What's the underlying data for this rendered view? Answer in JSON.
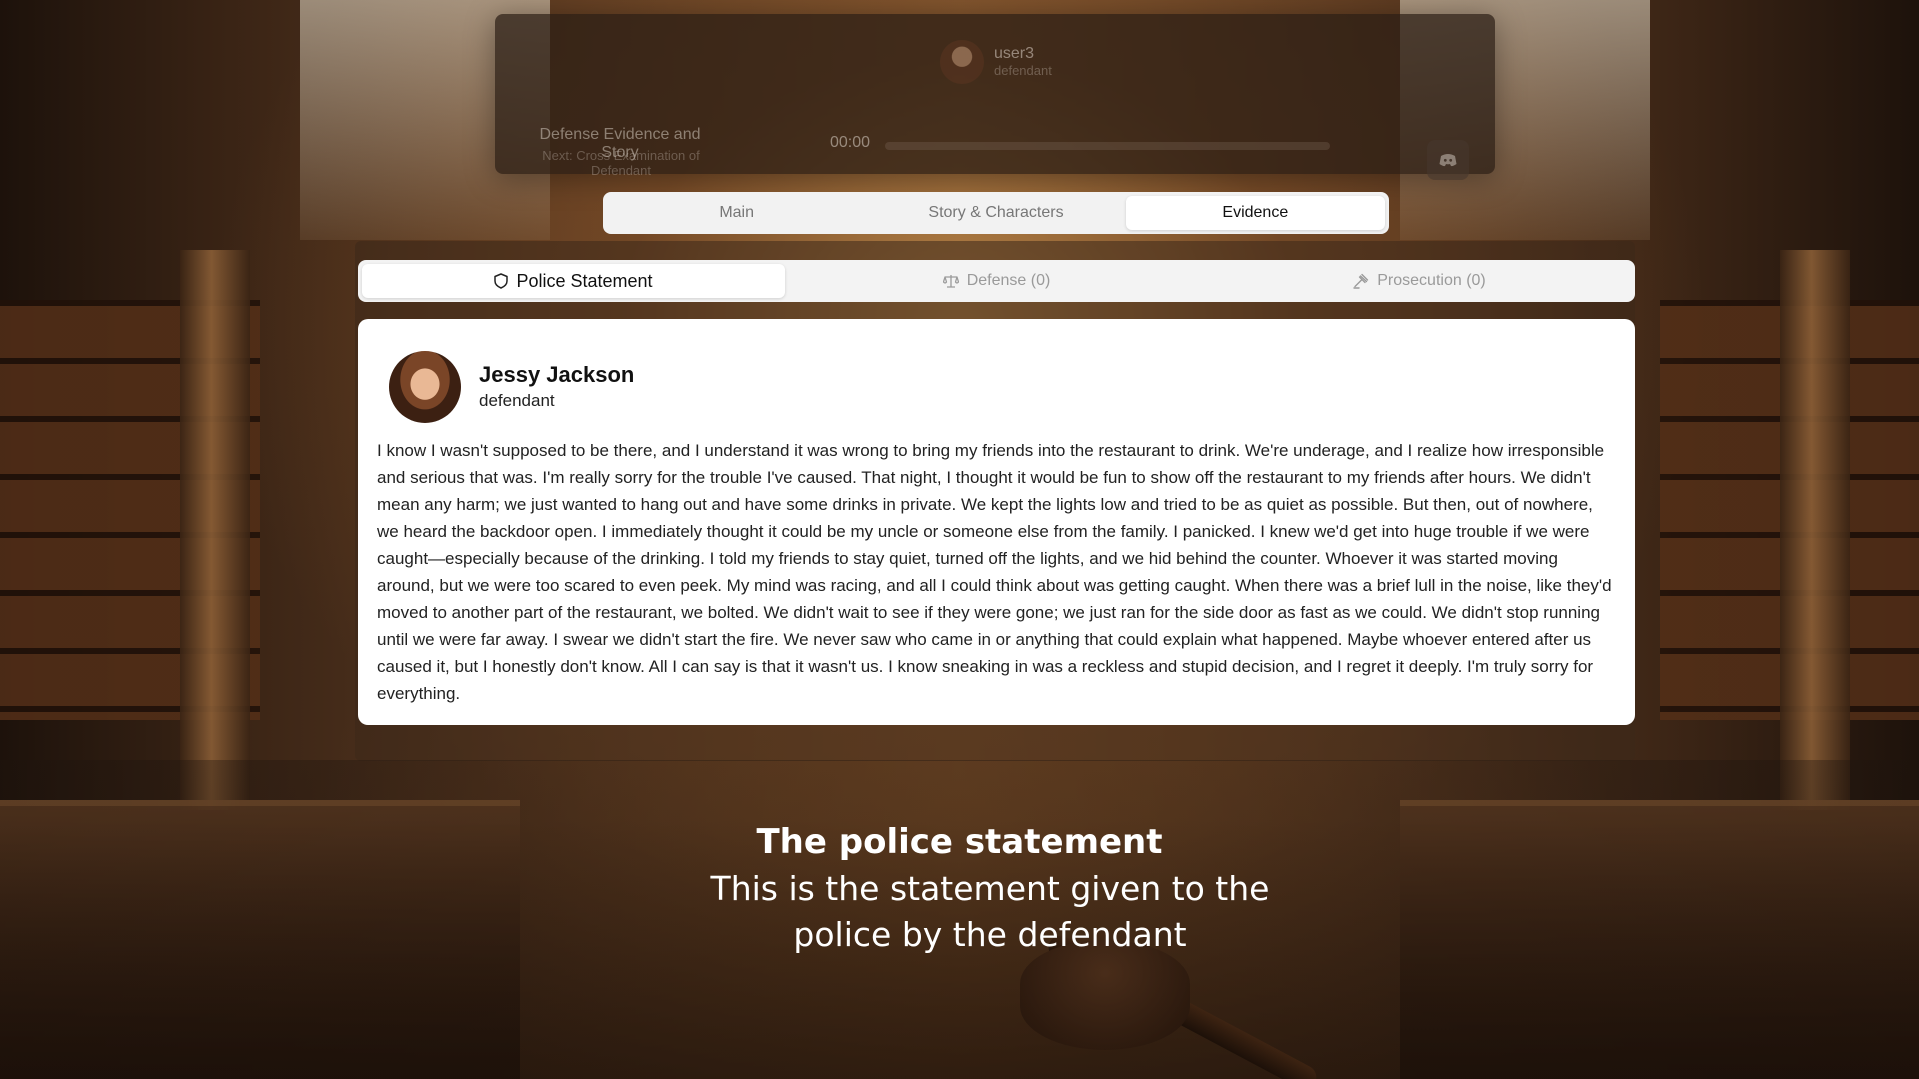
{
  "player": {
    "user_name": "user3",
    "user_role": "defendant",
    "phase_title": "Defense Evidence and Story",
    "phase_next": "Next: Cross Examination of Defendant",
    "timer": "00:00",
    "progress_fraction": 0
  },
  "main_tabs": [
    {
      "label": "Main",
      "active": false
    },
    {
      "label": "Story & Characters",
      "active": false
    },
    {
      "label": "Evidence",
      "active": true
    }
  ],
  "evidence_tabs": [
    {
      "label": "Police Statement",
      "icon": "shield-icon",
      "active": true
    },
    {
      "label": "Defense (0)",
      "icon": "scale-icon",
      "active": false
    },
    {
      "label": "Prosecution (0)",
      "icon": "gavel-icon",
      "active": false
    }
  ],
  "statement": {
    "name": "Jessy Jackson",
    "role": "defendant",
    "text": "I know I wasn't supposed to be there, and I understand it was wrong to bring my friends into the restaurant to drink. We're underage, and I realize how irresponsible and serious that was. I'm really sorry for the trouble I've caused. That night, I thought it would be fun to show off the restaurant to my friends after hours. We didn't mean any harm; we just wanted to hang out and have some drinks in private. We kept the lights low and tried to be as quiet as possible. But then, out of nowhere, we heard the backdoor open. I immediately thought it could be my uncle or someone else from the family. I panicked. I knew we'd get into huge trouble if we were caught—especially because of the drinking. I told my friends to stay quiet, turned off the lights, and we hid behind the counter. Whoever it was started moving around, but we were too scared to even peek. My mind was racing, and all I could think about was getting caught. When there was a brief lull in the noise, like they'd moved to another part of the restaurant, we bolted. We didn't wait to see if they were gone; we just ran for the side door as fast as we could. We didn't stop running until we were far away. I swear we didn't start the fire. We never saw who came in or anything that could explain what happened. Maybe whoever entered after us caused it, but I honestly don't know. All I can say is that it wasn't us. I know sneaking in was a reckless and stupid decision, and I regret it deeply. I'm truly sorry for everything."
  },
  "caption": {
    "title": "The police statement",
    "body": "This is the statement given to the police by the defendant"
  },
  "colors": {
    "tab_bg": "#f2f2f2",
    "tab_active": "#ffffff",
    "card_bg": "#ffffff"
  }
}
